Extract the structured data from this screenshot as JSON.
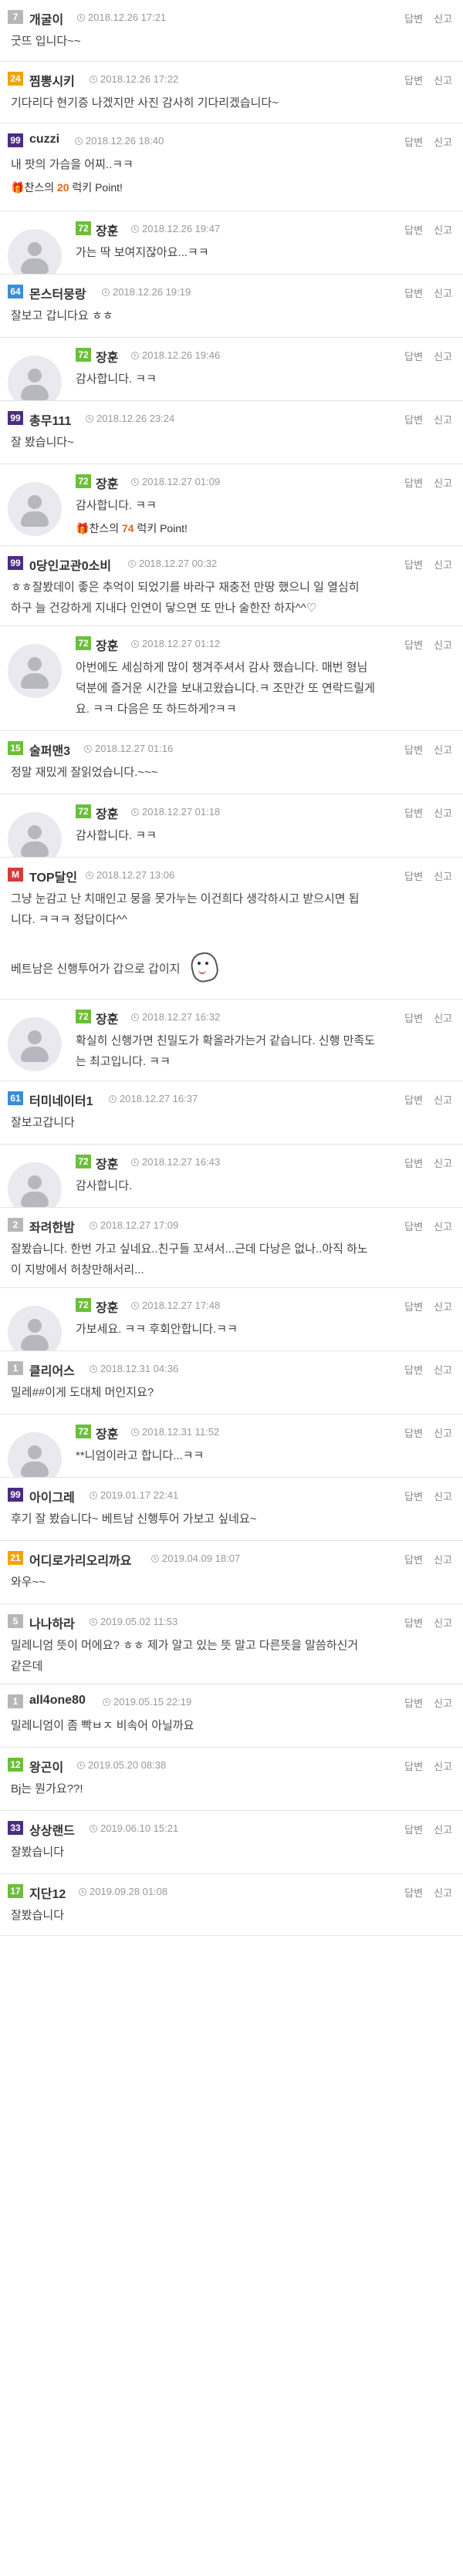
{
  "actions": {
    "reply": "답변",
    "report": "신고"
  },
  "point_text": {
    "prefix": "찬스의",
    "suffix": "럭키 Point!"
  },
  "comments": [
    {
      "type": "top",
      "level": "7",
      "level_color": "#b7b7b7",
      "nick": "개굴이",
      "time": "2018.12.26 17:21",
      "lines": [
        "굿뜨 입니다~~"
      ],
      "h": 80
    },
    {
      "type": "top",
      "level": "24",
      "level_color": "#f0a30a",
      "nick": "찜뽕시키",
      "time": "2018.12.26 17:22",
      "lines": [
        "기다리다 현기증 나겠지만 사진 감사히 기다리겠습니다~"
      ],
      "h": 80
    },
    {
      "type": "top",
      "level": "99",
      "level_color": "#4b2d83",
      "nick": "cuzzi",
      "time": "2018.12.26 18:40",
      "lines": [
        "내 팟의 가슴을 어찌..ㅋㅋ"
      ],
      "point": "20",
      "h": 114
    },
    {
      "type": "reply",
      "level": "72",
      "level_color": "#6bbf3a",
      "nick": "장훈",
      "time": "2018.12.26 19:47",
      "lines": [
        "가는 딱 보여지잖아요...ㅋㅋ"
      ],
      "h": 82
    },
    {
      "type": "top",
      "level": "64",
      "level_color": "#3a8dd8",
      "nick": "몬스터뭉랑",
      "time": "2018.12.26 19:19",
      "lines": [
        "잘보고 갑니다요 ㅎㅎ"
      ],
      "h": 82
    },
    {
      "type": "reply",
      "level": "72",
      "level_color": "#6bbf3a",
      "nick": "장훈",
      "time": "2018.12.26 19:46",
      "lines": [
        "감사합니다. ㅋㅋ"
      ],
      "h": 82
    },
    {
      "type": "top",
      "level": "99",
      "level_color": "#4b2d83",
      "nick": "총무111",
      "time": "2018.12.26 23:24",
      "lines": [
        "잘 봤습니다~"
      ],
      "h": 82
    },
    {
      "type": "reply",
      "level": "72",
      "level_color": "#6bbf3a",
      "nick": "장훈",
      "time": "2018.12.27 01:09",
      "lines": [
        "감사합니다. ㅋㅋ"
      ],
      "point": "74",
      "h": 106
    },
    {
      "type": "top",
      "level": "99",
      "level_color": "#4b2d83",
      "nick": "0당인교관0소비",
      "time": "2018.12.27 00:32",
      "lines": [
        "ㅎㅎ잘봤데이 좋은 추억이 되었기를 바라구 재충전 만땅 했으니 일 열심히",
        "하구 늘 건강하게 지내다 인연이 닿으면 또 만나 술한잔 하자^^♡"
      ],
      "h": 104
    },
    {
      "type": "reply",
      "level": "72",
      "level_color": "#6bbf3a",
      "nick": "장훈",
      "time": "2018.12.27 01:12",
      "lines": [
        "아번에도 세심하게 많이 챙겨주셔서 감사 했습니다. 매번 형님",
        "덕분에 즐거운 시간을 보내고왔습니다.ㅋ 조만간 또 연락드릴게",
        "요. ㅋㅋ 다음은 또 하드하게?ㅋㅋ"
      ],
      "h": 136
    },
    {
      "type": "top",
      "level": "15",
      "level_color": "#6bbf3a",
      "nick": "술퍼맨3",
      "time": "2018.12.27 01:16",
      "lines": [
        "정말 재밌게 잘읽었습니다.~~~"
      ],
      "h": 82
    },
    {
      "type": "reply",
      "level": "72",
      "level_color": "#6bbf3a",
      "nick": "장훈",
      "time": "2018.12.27 01:18",
      "lines": [
        "감사합니다. ㅋㅋ"
      ],
      "h": 82
    },
    {
      "type": "top",
      "level": "M",
      "level_color": "#d93a3a",
      "nick": "TOP달인",
      "time": "2018.12.27 13:06",
      "lines": [
        "그냥 눈감고 난 치매인고 뭉을 못가누는 이건희다 생각하시고 받으시면 됩",
        "니다. ㅋㅋㅋ 정답이다^^",
        "",
        "베트남은 신행투어가 갑으로 갑이지"
      ],
      "sticker": true,
      "h": 184
    },
    {
      "type": "reply",
      "level": "72",
      "level_color": "#6bbf3a",
      "nick": "장훈",
      "time": "2018.12.27 16:32",
      "lines": [
        "확실히 신행가면 친밀도가 확올라가는거 같습니다. 신행 만족도",
        "는 최고입니다. ㅋㅋ"
      ],
      "h": 106
    },
    {
      "type": "top",
      "level": "61",
      "level_color": "#3a8dd8",
      "nick": "터미네이터1",
      "time": "2018.12.27 16:37",
      "lines": [
        "잘보고갑니다"
      ],
      "h": 82
    },
    {
      "type": "reply",
      "level": "72",
      "level_color": "#6bbf3a",
      "nick": "장훈",
      "time": "2018.12.27 16:43",
      "lines": [
        "감사합니다."
      ],
      "h": 82
    },
    {
      "type": "top",
      "level": "2",
      "level_color": "#b7b7b7",
      "nick": "좌려한밤",
      "time": "2018.12.27 17:09",
      "lines": [
        "잘봤습니다. 한번 가고 싶네요..친구들 꼬셔서...근데 다낭은 없나..아직 하노",
        "이 지방에서 허창만해서리..."
      ],
      "h": 104
    },
    {
      "type": "reply",
      "level": "72",
      "level_color": "#6bbf3a",
      "nick": "장훈",
      "time": "2018.12.27 17:48",
      "lines": [
        "가보세요. ㅋㅋ 후회안합니다.ㅋㅋ"
      ],
      "h": 82
    },
    {
      "type": "top",
      "level": "1",
      "level_color": "#b7b7b7",
      "nick": "클리어스",
      "time": "2018.12.31 04:36",
      "lines": [
        "밀레##이게 도대체 머인지요?"
      ],
      "h": 82
    },
    {
      "type": "reply",
      "level": "72",
      "level_color": "#6bbf3a",
      "nick": "장훈",
      "time": "2018.12.31 11:52",
      "lines": [
        "**니엄이라고 합니다...ㅋㅋ"
      ],
      "h": 82
    },
    {
      "type": "top",
      "level": "99",
      "level_color": "#4b2d83",
      "nick": "아이그레",
      "time": "2019.01.17 22:41",
      "lines": [
        "후기 잘 봤습니다~ 베트남 신행투어 가보고 싶네요~"
      ],
      "h": 82
    },
    {
      "type": "top",
      "level": "21",
      "level_color": "#f0a30a",
      "nick": "어디로가리오리까요",
      "time": "2019.04.09 18:07",
      "lines": [
        "와우~~"
      ],
      "h": 82
    },
    {
      "type": "top",
      "level": "5",
      "level_color": "#b7b7b7",
      "nick": "나나하라",
      "time": "2019.05.02 11:53",
      "lines": [
        "밀레니엄 뜻이 머에요? ㅎㅎ 제가 알고 있는 뜻 말고 다른뜻을 말씀하신거",
        "같은데"
      ],
      "h": 104
    },
    {
      "type": "top",
      "level": "1",
      "level_color": "#b7b7b7",
      "nick": "all4one80",
      "time": "2019.05.15 22:19",
      "lines": [
        "밀레니엄이 좀 빡ㅂㅈ 비속어 아닐까요"
      ],
      "h": 82
    },
    {
      "type": "top",
      "level": "12",
      "level_color": "#6bbf3a",
      "nick": "왕곤이",
      "time": "2019.05.20 08:38",
      "lines": [
        "Bj는 뭔가요??!"
      ],
      "h": 82
    },
    {
      "type": "top",
      "level": "33",
      "level_color": "#4b2d83",
      "nick": "상상랜드",
      "time": "2019.06.10 15:21",
      "lines": [
        "잘봤습니다"
      ],
      "h": 82
    },
    {
      "type": "top",
      "level": "17",
      "level_color": "#6bbf3a",
      "nick": "지단12",
      "time": "2019.09.28 01:08",
      "lines": [
        "잘봤습니다"
      ],
      "h": 80
    }
  ]
}
